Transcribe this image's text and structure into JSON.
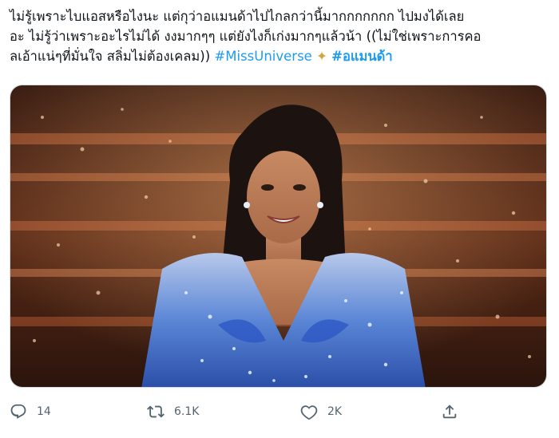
{
  "tweet": {
    "line1": "ไม่รู้เพราะไบแอสหรือไงนะ แต่กุว่าอแมนด้าไปไกลกว่านี้มากกกกกกก ไปมงได้เลย",
    "line2": "อะ ไม่รู้ว่าเพราะอะไรไม่ได้ งงมากๆๆ แต่ยังไงก็เก่งมากๆแล้วน้า ((ไม่ใช่เพราะการคอ",
    "line3_text": "ลเอ้าแน่ๆที่มั่นใจ สลิ่มไม่ต้องเคลม)) ",
    "hashtag1": "#MissUniverse",
    "sparkle": "✦",
    "hashtag2": "#อแมนด้า"
  },
  "media": {
    "description_icon": "photo"
  },
  "actions": {
    "reply_count": "14",
    "retweet_count": "6.1K",
    "like_count": "2K"
  },
  "icons": {
    "reply": "reply-icon",
    "retweet": "retweet-icon",
    "like": "heart-icon",
    "share": "share-icon"
  },
  "colors": {
    "text": "#0f1419",
    "hashtag": "#1d9bf0",
    "action": "#536471"
  }
}
